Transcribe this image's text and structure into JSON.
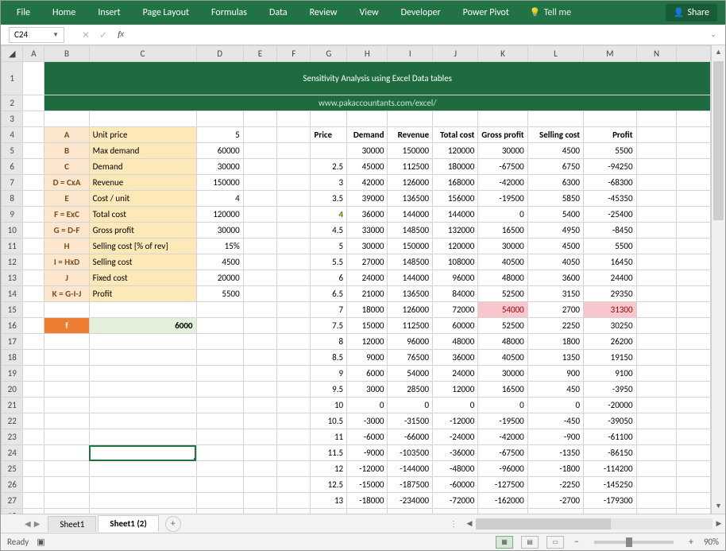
{
  "ribbon": {
    "tabs": [
      "File",
      "Home",
      "Insert",
      "Page Layout",
      "Formulas",
      "Data",
      "Review",
      "View",
      "Developer",
      "Power Pivot"
    ],
    "tellme": "Tell me",
    "share": "Share"
  },
  "namebox": "C24",
  "formula": "",
  "title1": "Sensitivity Analysis using Excel Data tables",
  "title2": "www.pakaccountants.com/excel/",
  "columns": [
    "A",
    "B",
    "C",
    "D",
    "E",
    "F",
    "G",
    "H",
    "I",
    "J",
    "K",
    "L",
    "M",
    "N"
  ],
  "model": {
    "rows": [
      {
        "key": "A",
        "label": "Unit price",
        "value": "5"
      },
      {
        "key": "B",
        "label": "Max demand",
        "value": "60000"
      },
      {
        "key": "C",
        "label": "Demand",
        "value": "30000"
      },
      {
        "key": "D = CxA",
        "label": "Revenue",
        "value": "150000"
      },
      {
        "key": "E",
        "label": "Cost / unit",
        "value": "4"
      },
      {
        "key": "F = ExC",
        "label": "Total cost",
        "value": "120000"
      },
      {
        "key": "G = D-F",
        "label": "Gross profit",
        "value": "30000"
      },
      {
        "key": "H",
        "label": "Selling cost [% of rev]",
        "value": "15%"
      },
      {
        "key": "I = HxD",
        "label": "Selling cost",
        "value": "4500"
      },
      {
        "key": "J",
        "label": "Fixed cost",
        "value": "20000"
      },
      {
        "key": "K = G-I-J",
        "label": "Profit",
        "value": "5500"
      }
    ],
    "f_label": "f",
    "f_value": "6000"
  },
  "table": {
    "headers": [
      "Price",
      "Demand",
      "Revenue",
      "Total cost",
      "Gross profit",
      "Selling cost",
      "Profit"
    ],
    "base": [
      "",
      "30000",
      "150000",
      "120000",
      "30000",
      "4500",
      "5500"
    ],
    "rows": [
      [
        "2.5",
        "45000",
        "112500",
        "180000",
        "-67500",
        "6750",
        "-94250"
      ],
      [
        "3",
        "42000",
        "126000",
        "168000",
        "-42000",
        "6300",
        "-68300"
      ],
      [
        "3.5",
        "39000",
        "136500",
        "156000",
        "-19500",
        "5850",
        "-45350"
      ],
      [
        "4",
        "36000",
        "144000",
        "144000",
        "0",
        "5400",
        "-25400"
      ],
      [
        "4.5",
        "33000",
        "148500",
        "132000",
        "16500",
        "4950",
        "-8450"
      ],
      [
        "5",
        "30000",
        "150000",
        "120000",
        "30000",
        "4500",
        "5500"
      ],
      [
        "5.5",
        "27000",
        "148500",
        "108000",
        "40500",
        "4050",
        "16450"
      ],
      [
        "6",
        "24000",
        "144000",
        "96000",
        "48000",
        "3600",
        "24400"
      ],
      [
        "6.5",
        "21000",
        "136500",
        "84000",
        "52500",
        "3150",
        "29350"
      ],
      [
        "7",
        "18000",
        "126000",
        "72000",
        "54000",
        "2700",
        "31300"
      ],
      [
        "7.5",
        "15000",
        "112500",
        "60000",
        "52500",
        "2250",
        "30250"
      ],
      [
        "8",
        "12000",
        "96000",
        "48000",
        "48000",
        "1800",
        "26200"
      ],
      [
        "8.5",
        "9000",
        "76500",
        "36000",
        "40500",
        "1350",
        "19150"
      ],
      [
        "9",
        "6000",
        "54000",
        "24000",
        "30000",
        "900",
        "9100"
      ],
      [
        "9.5",
        "3000",
        "28500",
        "12000",
        "16500",
        "450",
        "-3950"
      ],
      [
        "10",
        "0",
        "0",
        "0",
        "0",
        "0",
        "-20000"
      ],
      [
        "10.5",
        "-3000",
        "-31500",
        "-12000",
        "-19500",
        "-450",
        "-39050"
      ],
      [
        "11",
        "-6000",
        "-66000",
        "-24000",
        "-42000",
        "-900",
        "-61100"
      ],
      [
        "11.5",
        "-9000",
        "-103500",
        "-36000",
        "-67500",
        "-1350",
        "-86150"
      ],
      [
        "12",
        "-12000",
        "-144000",
        "-48000",
        "-96000",
        "-1800",
        "-114200"
      ],
      [
        "12.5",
        "-15000",
        "-187500",
        "-60000",
        "-127500",
        "-2250",
        "-145250"
      ],
      [
        "13",
        "-18000",
        "-234000",
        "-72000",
        "-162000",
        "-2700",
        "-179300"
      ]
    ]
  },
  "sheets": {
    "inactive": "Sheet1",
    "active": "Sheet1 (2)"
  },
  "status": {
    "ready": "Ready",
    "zoom": "90%"
  }
}
